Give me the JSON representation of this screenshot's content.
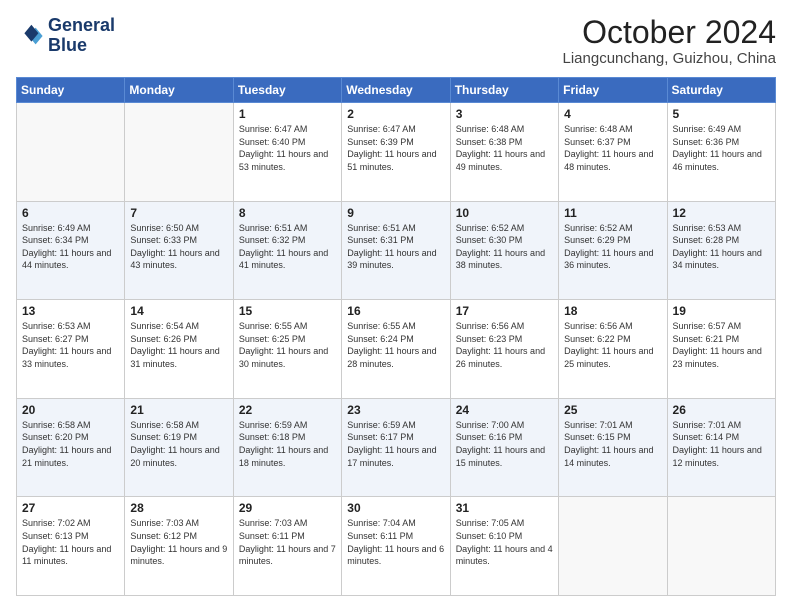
{
  "header": {
    "logo_line1": "General",
    "logo_line2": "Blue",
    "month_title": "October 2024",
    "location": "Liangcunchang, Guizhou, China"
  },
  "weekdays": [
    "Sunday",
    "Monday",
    "Tuesday",
    "Wednesday",
    "Thursday",
    "Friday",
    "Saturday"
  ],
  "weeks": [
    [
      {
        "day": "",
        "sunrise": "",
        "sunset": "",
        "daylight": ""
      },
      {
        "day": "",
        "sunrise": "",
        "sunset": "",
        "daylight": ""
      },
      {
        "day": "1",
        "sunrise": "Sunrise: 6:47 AM",
        "sunset": "Sunset: 6:40 PM",
        "daylight": "Daylight: 11 hours and 53 minutes."
      },
      {
        "day": "2",
        "sunrise": "Sunrise: 6:47 AM",
        "sunset": "Sunset: 6:39 PM",
        "daylight": "Daylight: 11 hours and 51 minutes."
      },
      {
        "day": "3",
        "sunrise": "Sunrise: 6:48 AM",
        "sunset": "Sunset: 6:38 PM",
        "daylight": "Daylight: 11 hours and 49 minutes."
      },
      {
        "day": "4",
        "sunrise": "Sunrise: 6:48 AM",
        "sunset": "Sunset: 6:37 PM",
        "daylight": "Daylight: 11 hours and 48 minutes."
      },
      {
        "day": "5",
        "sunrise": "Sunrise: 6:49 AM",
        "sunset": "Sunset: 6:36 PM",
        "daylight": "Daylight: 11 hours and 46 minutes."
      }
    ],
    [
      {
        "day": "6",
        "sunrise": "Sunrise: 6:49 AM",
        "sunset": "Sunset: 6:34 PM",
        "daylight": "Daylight: 11 hours and 44 minutes."
      },
      {
        "day": "7",
        "sunrise": "Sunrise: 6:50 AM",
        "sunset": "Sunset: 6:33 PM",
        "daylight": "Daylight: 11 hours and 43 minutes."
      },
      {
        "day": "8",
        "sunrise": "Sunrise: 6:51 AM",
        "sunset": "Sunset: 6:32 PM",
        "daylight": "Daylight: 11 hours and 41 minutes."
      },
      {
        "day": "9",
        "sunrise": "Sunrise: 6:51 AM",
        "sunset": "Sunset: 6:31 PM",
        "daylight": "Daylight: 11 hours and 39 minutes."
      },
      {
        "day": "10",
        "sunrise": "Sunrise: 6:52 AM",
        "sunset": "Sunset: 6:30 PM",
        "daylight": "Daylight: 11 hours and 38 minutes."
      },
      {
        "day": "11",
        "sunrise": "Sunrise: 6:52 AM",
        "sunset": "Sunset: 6:29 PM",
        "daylight": "Daylight: 11 hours and 36 minutes."
      },
      {
        "day": "12",
        "sunrise": "Sunrise: 6:53 AM",
        "sunset": "Sunset: 6:28 PM",
        "daylight": "Daylight: 11 hours and 34 minutes."
      }
    ],
    [
      {
        "day": "13",
        "sunrise": "Sunrise: 6:53 AM",
        "sunset": "Sunset: 6:27 PM",
        "daylight": "Daylight: 11 hours and 33 minutes."
      },
      {
        "day": "14",
        "sunrise": "Sunrise: 6:54 AM",
        "sunset": "Sunset: 6:26 PM",
        "daylight": "Daylight: 11 hours and 31 minutes."
      },
      {
        "day": "15",
        "sunrise": "Sunrise: 6:55 AM",
        "sunset": "Sunset: 6:25 PM",
        "daylight": "Daylight: 11 hours and 30 minutes."
      },
      {
        "day": "16",
        "sunrise": "Sunrise: 6:55 AM",
        "sunset": "Sunset: 6:24 PM",
        "daylight": "Daylight: 11 hours and 28 minutes."
      },
      {
        "day": "17",
        "sunrise": "Sunrise: 6:56 AM",
        "sunset": "Sunset: 6:23 PM",
        "daylight": "Daylight: 11 hours and 26 minutes."
      },
      {
        "day": "18",
        "sunrise": "Sunrise: 6:56 AM",
        "sunset": "Sunset: 6:22 PM",
        "daylight": "Daylight: 11 hours and 25 minutes."
      },
      {
        "day": "19",
        "sunrise": "Sunrise: 6:57 AM",
        "sunset": "Sunset: 6:21 PM",
        "daylight": "Daylight: 11 hours and 23 minutes."
      }
    ],
    [
      {
        "day": "20",
        "sunrise": "Sunrise: 6:58 AM",
        "sunset": "Sunset: 6:20 PM",
        "daylight": "Daylight: 11 hours and 21 minutes."
      },
      {
        "day": "21",
        "sunrise": "Sunrise: 6:58 AM",
        "sunset": "Sunset: 6:19 PM",
        "daylight": "Daylight: 11 hours and 20 minutes."
      },
      {
        "day": "22",
        "sunrise": "Sunrise: 6:59 AM",
        "sunset": "Sunset: 6:18 PM",
        "daylight": "Daylight: 11 hours and 18 minutes."
      },
      {
        "day": "23",
        "sunrise": "Sunrise: 6:59 AM",
        "sunset": "Sunset: 6:17 PM",
        "daylight": "Daylight: 11 hours and 17 minutes."
      },
      {
        "day": "24",
        "sunrise": "Sunrise: 7:00 AM",
        "sunset": "Sunset: 6:16 PM",
        "daylight": "Daylight: 11 hours and 15 minutes."
      },
      {
        "day": "25",
        "sunrise": "Sunrise: 7:01 AM",
        "sunset": "Sunset: 6:15 PM",
        "daylight": "Daylight: 11 hours and 14 minutes."
      },
      {
        "day": "26",
        "sunrise": "Sunrise: 7:01 AM",
        "sunset": "Sunset: 6:14 PM",
        "daylight": "Daylight: 11 hours and 12 minutes."
      }
    ],
    [
      {
        "day": "27",
        "sunrise": "Sunrise: 7:02 AM",
        "sunset": "Sunset: 6:13 PM",
        "daylight": "Daylight: 11 hours and 11 minutes."
      },
      {
        "day": "28",
        "sunrise": "Sunrise: 7:03 AM",
        "sunset": "Sunset: 6:12 PM",
        "daylight": "Daylight: 11 hours and 9 minutes."
      },
      {
        "day": "29",
        "sunrise": "Sunrise: 7:03 AM",
        "sunset": "Sunset: 6:11 PM",
        "daylight": "Daylight: 11 hours and 7 minutes."
      },
      {
        "day": "30",
        "sunrise": "Sunrise: 7:04 AM",
        "sunset": "Sunset: 6:11 PM",
        "daylight": "Daylight: 11 hours and 6 minutes."
      },
      {
        "day": "31",
        "sunrise": "Sunrise: 7:05 AM",
        "sunset": "Sunset: 6:10 PM",
        "daylight": "Daylight: 11 hours and 4 minutes."
      },
      {
        "day": "",
        "sunrise": "",
        "sunset": "",
        "daylight": ""
      },
      {
        "day": "",
        "sunrise": "",
        "sunset": "",
        "daylight": ""
      }
    ]
  ]
}
